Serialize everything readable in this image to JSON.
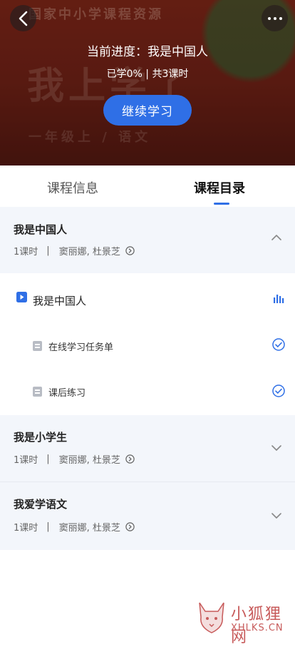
{
  "hero": {
    "bg_text_top": "国家中小学课程资源",
    "bg_text_main": "我上学了",
    "bg_text_sub": "一年级上 / 语文",
    "progress_title": "当前进度：我是中国人",
    "progress_sub": "已学0% | 共3课时",
    "continue_label": "继续学习",
    "progress_percent": 0
  },
  "tabs": [
    {
      "label": "课程信息",
      "active": false
    },
    {
      "label": "课程目录",
      "active": true
    }
  ],
  "units": [
    {
      "title": "我是中国人",
      "hours": "1课时",
      "separator": "|",
      "teachers": "窦丽娜, 杜景芝",
      "expanded": true,
      "lessons": [
        {
          "label": "我是中国人",
          "status_icon": "playing-bars-icon"
        },
        {
          "label": "在线学习任务单",
          "status_icon": "check-circle-icon"
        },
        {
          "label": "课后练习",
          "status_icon": "check-circle-icon"
        }
      ]
    },
    {
      "title": "我是小学生",
      "hours": "1课时",
      "separator": "|",
      "teachers": "窦丽娜, 杜景芝",
      "expanded": false
    },
    {
      "title": "我爱学语文",
      "hours": "1课时",
      "separator": "|",
      "teachers": "窦丽娜, 杜景芝",
      "expanded": false
    }
  ],
  "watermark": {
    "name": "小狐狸网",
    "url": "XHLKS.CN"
  },
  "colors": {
    "accent": "#2f6fe6",
    "section_bg": "#f3f6fb",
    "hero_bg": "#7a2418"
  }
}
